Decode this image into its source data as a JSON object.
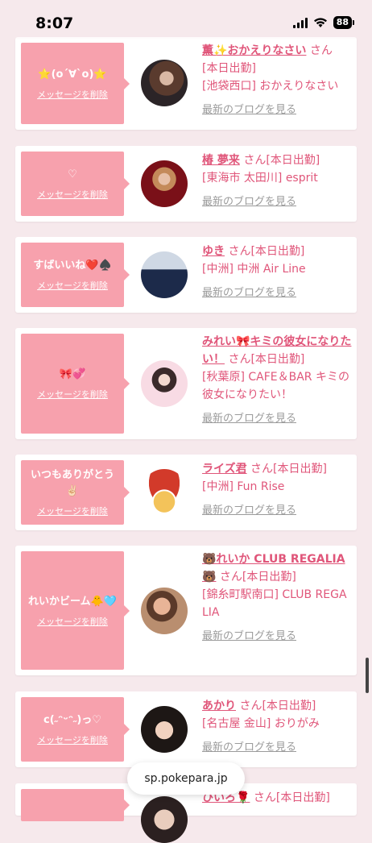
{
  "status": {
    "time": "8:07",
    "battery": "88"
  },
  "url": "sp.pokepara.jp",
  "delete_label": "メッセージを削除",
  "blog_label": "最新のブログを見る",
  "san_label": "さん",
  "cards": [
    {
      "message": "⭐(o´∀`o)⭐",
      "name": "薫✨おかえりなさい",
      "honor": "[本日出勤]",
      "shop": "[池袋西口] おかえりなさい"
    },
    {
      "message": "♡",
      "name": "椿 夢来",
      "honor": "[本日出勤]",
      "shop": "[東海市 太田川] esprit"
    },
    {
      "message": "すばいいね❤️♠️",
      "name": "ゆき",
      "honor": "[本日出勤]",
      "shop": "[中洲] 中洲 Air Line"
    },
    {
      "message": "🎀💞",
      "name": "みれい🎀キミの彼女になりたい！",
      "honor": "[本日出勤]",
      "shop": "[秋葉原] CAFE＆BAR キミの彼女になりたい！"
    },
    {
      "message": "いつもありがとう✌🏻",
      "name": "ライズ君",
      "honor": "[本日出勤]",
      "shop": "[中洲] Fun Rise"
    },
    {
      "message": "れいかビーム🐥🩵",
      "name": "🐻れいか CLUB REGALIA🐻",
      "honor": "[本日出勤]",
      "shop": "[錦糸町駅南口] CLUB REGALIA"
    },
    {
      "message": "c(˶ᵔᵕᵔ˶)っ♡",
      "name": "あかり",
      "honor": "[本日出勤]",
      "shop": "[名古屋 金山] おりがみ"
    },
    {
      "message": "",
      "name": "ひいろ🌹",
      "honor": "[本日出勤]",
      "shop": ""
    }
  ],
  "colors": {
    "accent": "#e0567a",
    "bubble": "#f7a1ad",
    "background": "#f6e9ec"
  }
}
